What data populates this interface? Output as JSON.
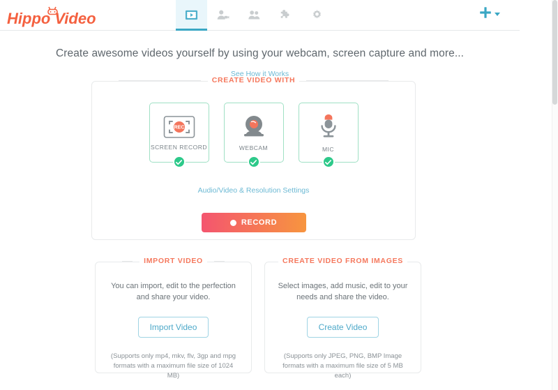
{
  "brand": {
    "name": "Hippo Video",
    "color": "#f4603f"
  },
  "header": {
    "tabs": [
      {
        "icon": "film-strip-play-icon",
        "name": "videos",
        "active": true
      },
      {
        "icon": "person-video-icon",
        "name": "my-recordings",
        "active": false
      },
      {
        "icon": "people-group-icon",
        "name": "contacts",
        "active": false
      },
      {
        "icon": "puzzle-piece-icon",
        "name": "integrations",
        "active": false
      },
      {
        "icon": "gear-icon",
        "name": "settings",
        "active": false
      }
    ],
    "add_button": {
      "icon": "plus-icon",
      "caret": "chevron-down-icon"
    },
    "accent_color": "#3aa7c4",
    "active_tab_bg": "#e9f6fb"
  },
  "hero": {
    "headline": "Create awesome videos yourself by using your webcam, screen capture and more...",
    "link_label": "See How it Works"
  },
  "create_panel": {
    "section_title": "CREATE VIDEO WITH",
    "section_title_color": "#f5785d",
    "options": [
      {
        "label": "SCREEN RECORD",
        "icon": "screen-record-icon",
        "selected": true
      },
      {
        "label": "WEBCAM",
        "icon": "webcam-icon",
        "selected": true
      },
      {
        "label": "MIC",
        "icon": "microphone-icon",
        "selected": true
      }
    ],
    "settings_link": "Audio/Video & Resolution Settings",
    "record_button": "RECORD",
    "record_gradient_from": "#f4556f",
    "record_gradient_to": "#f7953f",
    "check_color": "#2dc98a"
  },
  "import_panel": {
    "title": "IMPORT VIDEO",
    "description": "You can import, edit to the perfection and share your video.",
    "button": "Import Video",
    "note": "(Supports only mp4, mkv, flv, 3gp and mpg formats with a maximum file size of 1024 MB)"
  },
  "images_panel": {
    "title": "CREATE VIDEO FROM IMAGES",
    "description": "Select images, add music, edit to your needs and share the video.",
    "button": "Create Video",
    "note": "(Supports only JPEG, PNG, BMP Image formats with a maximum file size of 5 MB each)"
  }
}
